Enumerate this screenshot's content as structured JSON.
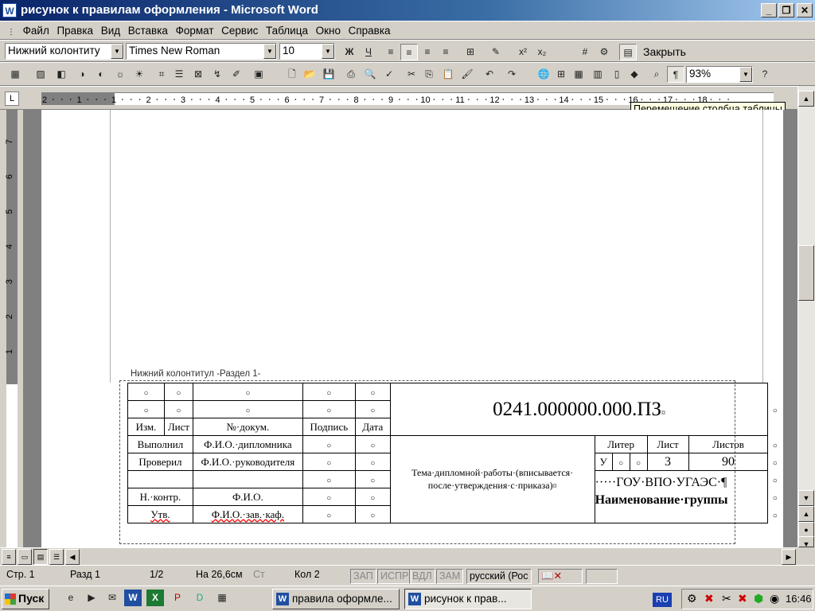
{
  "window": {
    "title": "рисунок к правилам оформления - Microsoft Word"
  },
  "menu": [
    "Файл",
    "Правка",
    "Вид",
    "Вставка",
    "Формат",
    "Сервис",
    "Таблица",
    "Окно",
    "Справка"
  ],
  "format_bar": {
    "style": "Нижний колонтиту",
    "font": "Times New Roman",
    "size": "10",
    "bold": "Ж",
    "underline": "Ч",
    "close": "Закрыть"
  },
  "toolbar2": {
    "zoom": "93%"
  },
  "ruler": {
    "numbers": [
      "2",
      "1",
      "1",
      "2",
      "3",
      "4",
      "5",
      "6",
      "7",
      "8",
      "9",
      "10",
      "11",
      "12",
      "13",
      "14",
      "15",
      "16",
      "17",
      "18"
    ],
    "tooltip": "Перемещение столбца таблицы",
    "tab_marker": "L"
  },
  "vruler_numbers": [
    "7",
    "6",
    "5",
    "4",
    "3",
    "2",
    "1"
  ],
  "header_label": "Нижний колонтитул -Раздел 1-",
  "stamp": {
    "code": "0241.000000.000.ПЗ",
    "col_headers": [
      "Изм.",
      "Лист",
      "№·докум.",
      "Подпись",
      "Дата"
    ],
    "rows": [
      {
        "role": "Выполнил",
        "name": "Ф.И.О.·дипломника"
      },
      {
        "role": "Проверил",
        "name": "Ф.И.О.·руководителя"
      },
      {
        "role": "",
        "name": ""
      },
      {
        "role": "Н.·контр.",
        "name": "Ф.И.О."
      },
      {
        "role": "Утв.",
        "name": "Ф.И.О.·зав.·каф."
      }
    ],
    "topic": "Тема·дипломной·работы·(вписывается· после·утверждения·с·приказа)",
    "liter": "Литер",
    "sheet": "Лист",
    "sheets": "Листов",
    "liter_value": "У",
    "sheet_value": "3",
    "sheets_value": "90",
    "org": "·····ГОУ·ВПО·УГАЭС·¶",
    "group": "Наименование·группы"
  },
  "status": {
    "page": "Стр. 1",
    "section": "Разд 1",
    "pages": "1/2",
    "at": "На 26,6см",
    "line": "Ст",
    "col": "Кол 2",
    "rec": "ЗАП",
    "trk": "ИСПР",
    "ext": "ВДЛ",
    "ovr": "ЗАМ",
    "lang": "русский (Рос"
  },
  "taskbar": {
    "start": "Пуск",
    "tasks": [
      "правила оформле...",
      "рисунок к прав..."
    ],
    "lang": "RU",
    "time": "16:46"
  }
}
